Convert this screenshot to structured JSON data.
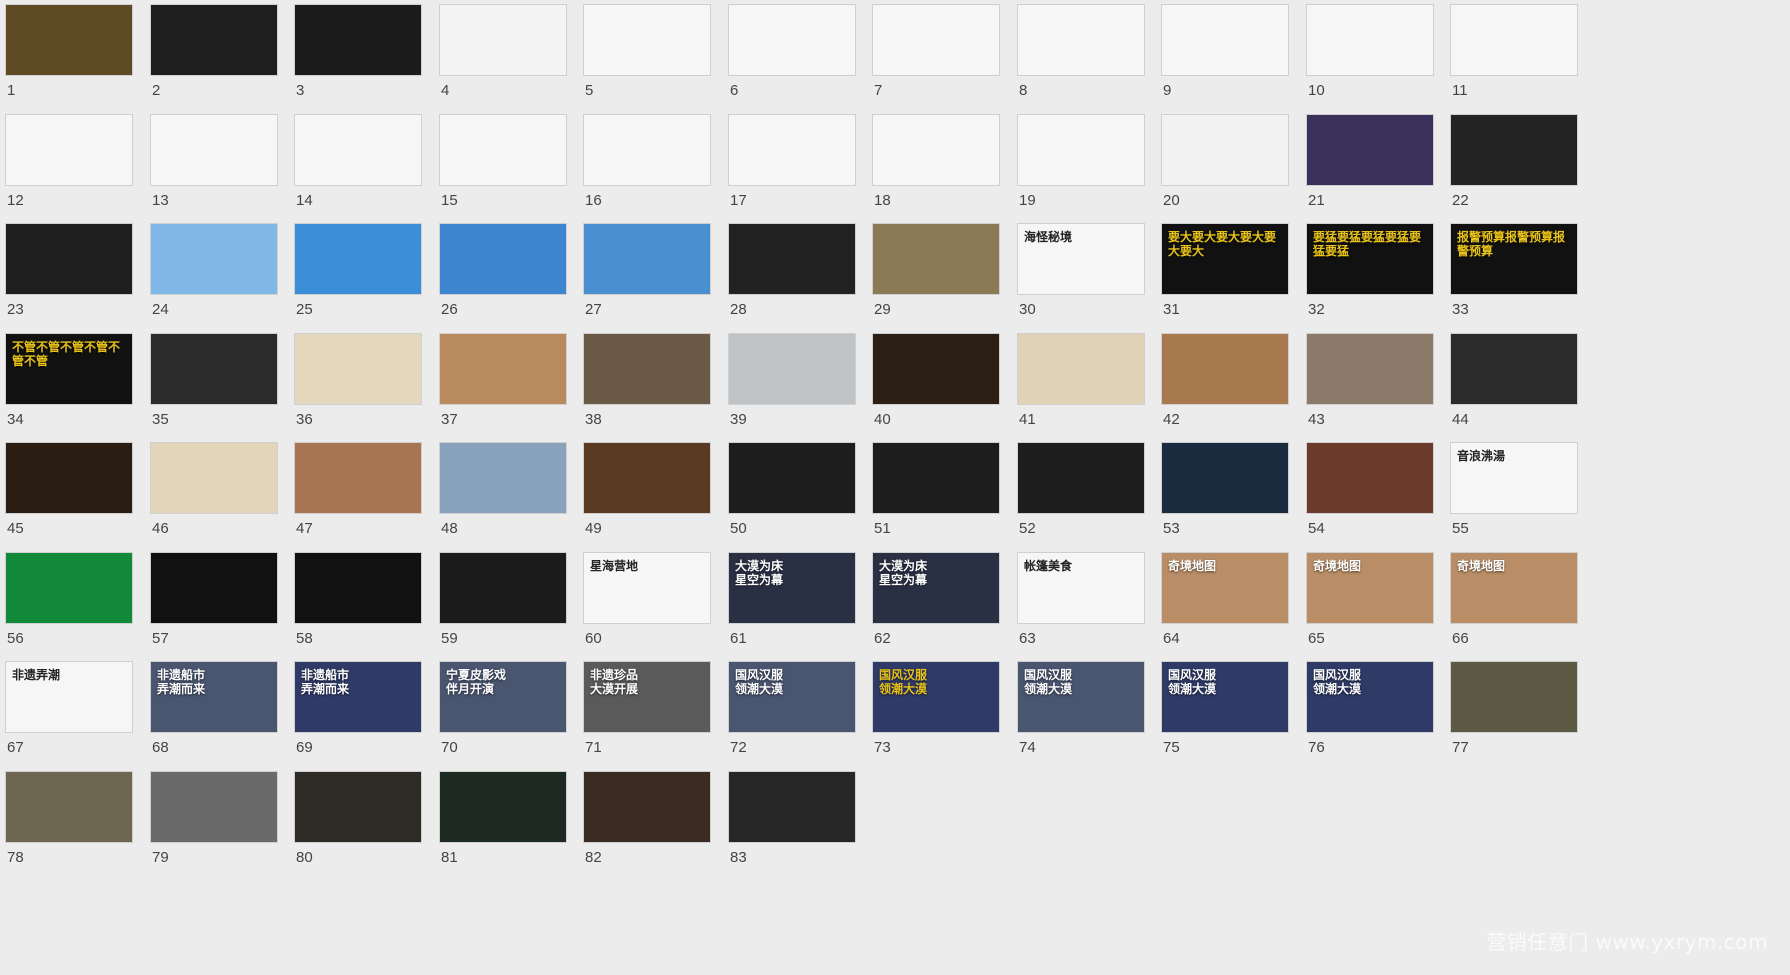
{
  "watermark": "营销任意门 www.yxrym.com",
  "slides": [
    {
      "n": "1",
      "bg": "#5e4a23"
    },
    {
      "n": "2",
      "bg": "#1f1f1f"
    },
    {
      "n": "3",
      "bg": "#1c1c1c"
    },
    {
      "n": "4",
      "bg": "#f4f4f4"
    },
    {
      "n": "5",
      "bg": "#f6f6f6"
    },
    {
      "n": "6",
      "bg": "#f6f6f6"
    },
    {
      "n": "7",
      "bg": "#f6f6f6"
    },
    {
      "n": "8",
      "bg": "#f6f6f6"
    },
    {
      "n": "9",
      "bg": "#f6f6f6"
    },
    {
      "n": "10",
      "bg": "#f6f6f6"
    },
    {
      "n": "11",
      "bg": "#f6f6f6"
    },
    {
      "n": "12",
      "bg": "#f6f6f6"
    },
    {
      "n": "13",
      "bg": "#f6f6f6"
    },
    {
      "n": "14",
      "bg": "#f6f6f6"
    },
    {
      "n": "15",
      "bg": "#f6f6f6"
    },
    {
      "n": "16",
      "bg": "#f6f6f6"
    },
    {
      "n": "17",
      "bg": "#f6f6f6"
    },
    {
      "n": "18",
      "bg": "#f6f6f6"
    },
    {
      "n": "19",
      "bg": "#f6f6f6"
    },
    {
      "n": "20",
      "bg": "#f2f2f2"
    },
    {
      "n": "21",
      "bg": "#3b2f5c"
    },
    {
      "n": "22",
      "bg": "#232323"
    },
    {
      "n": "23",
      "bg": "#1e1e1e"
    },
    {
      "n": "24",
      "bg": "#7fb8e6"
    },
    {
      "n": "25",
      "bg": "#3a8fd8"
    },
    {
      "n": "26",
      "bg": "#3d86cf"
    },
    {
      "n": "27",
      "bg": "#4a8fd0"
    },
    {
      "n": "28",
      "bg": "#222222"
    },
    {
      "n": "29",
      "bg": "#8a7a55"
    },
    {
      "n": "30",
      "bg": "#f6f6f6",
      "cap": "海怪秘境",
      "dark": true
    },
    {
      "n": "31",
      "bg": "#111111",
      "cap": "要大要大要大要大要大要大",
      "mark": "",
      "capColor": "#e8c21a"
    },
    {
      "n": "32",
      "bg": "#111111",
      "cap": "要猛要猛要猛要猛要猛要猛",
      "capColor": "#e8c21a"
    },
    {
      "n": "33",
      "bg": "#111111",
      "cap": "报警预算报警预算报警预算",
      "capColor": "#e8c21a"
    },
    {
      "n": "34",
      "bg": "#111111",
      "cap": "不管不管不管不管不管不管",
      "capColor": "#e8c21a"
    },
    {
      "n": "35",
      "bg": "#2b2b2b"
    },
    {
      "n": "36",
      "bg": "#e3d7be"
    },
    {
      "n": "37",
      "bg": "#b98a5e"
    },
    {
      "n": "38",
      "bg": "#6b5a46"
    },
    {
      "n": "39",
      "bg": "#bfc3c6"
    },
    {
      "n": "40",
      "bg": "#2c2016"
    },
    {
      "n": "41",
      "bg": "#e0d2b6"
    },
    {
      "n": "42",
      "bg": "#a8794e"
    },
    {
      "n": "43",
      "bg": "#8b7a6a"
    },
    {
      "n": "44",
      "bg": "#2b2b2b"
    },
    {
      "n": "45",
      "bg": "#2a1e14"
    },
    {
      "n": "46",
      "bg": "#e2d5ba"
    },
    {
      "n": "47",
      "bg": "#a77552"
    },
    {
      "n": "48",
      "bg": "#8aa3bd"
    },
    {
      "n": "49",
      "bg": "#5a3a22"
    },
    {
      "n": "50",
      "bg": "#1d1d1d"
    },
    {
      "n": "51",
      "bg": "#1d1d1d"
    },
    {
      "n": "52",
      "bg": "#1d1d1d"
    },
    {
      "n": "53",
      "bg": "#1a2b3f"
    },
    {
      "n": "54",
      "bg": "#6b3a2a"
    },
    {
      "n": "55",
      "bg": "#f6f6f6",
      "cap": "音浪沸湯",
      "dark": true
    },
    {
      "n": "56",
      "bg": "#138a3a"
    },
    {
      "n": "57",
      "bg": "#111111"
    },
    {
      "n": "58",
      "bg": "#111111"
    },
    {
      "n": "59",
      "bg": "#1c1c1c"
    },
    {
      "n": "60",
      "bg": "#f6f6f6",
      "cap": "星海营地",
      "dark": true
    },
    {
      "n": "61",
      "bg": "#2a3044",
      "cap": "大漠为床\n星空为幕"
    },
    {
      "n": "62",
      "bg": "#2a3044",
      "cap": "大漠为床\n星空为幕"
    },
    {
      "n": "63",
      "bg": "#f6f6f6",
      "cap": "帐篷美食",
      "dark": true
    },
    {
      "n": "64",
      "bg": "#b98d66",
      "cap": "奇境地图"
    },
    {
      "n": "65",
      "bg": "#b98d66",
      "cap": "奇境地图"
    },
    {
      "n": "66",
      "bg": "#b98d66",
      "cap": "奇境地图"
    },
    {
      "n": "67",
      "bg": "#f6f6f6",
      "cap": "非遗弄潮",
      "dark": true
    },
    {
      "n": "68",
      "bg": "#4a5570",
      "cap": "非遗船市\n弄潮而来"
    },
    {
      "n": "69",
      "bg": "#2f3a66",
      "cap": "非遗船市\n弄潮而来"
    },
    {
      "n": "70",
      "bg": "#4a5570",
      "cap": "宁夏皮影戏\n伴月开演"
    },
    {
      "n": "71",
      "bg": "#5a5a5a",
      "cap": "非遗珍品\n大漠开展"
    },
    {
      "n": "72",
      "bg": "#4a5570",
      "cap": "国风汉服\n领潮大漠"
    },
    {
      "n": "73",
      "bg": "#2f3a66",
      "cap": "国风汉服\n领潮大漠",
      "capColor": "#e8c21a"
    },
    {
      "n": "74",
      "bg": "#4a5570",
      "cap": "国风汉服\n领潮大漠"
    },
    {
      "n": "75",
      "bg": "#2f3a66",
      "cap": "国风汉服\n领潮大漠"
    },
    {
      "n": "76",
      "bg": "#2f3a66",
      "cap": "国风汉服\n领潮大漠"
    },
    {
      "n": "77",
      "bg": "#5c5a45"
    },
    {
      "n": "78",
      "bg": "#6e6650"
    },
    {
      "n": "79",
      "bg": "#6a6a6a"
    },
    {
      "n": "80",
      "bg": "#2e2a26"
    },
    {
      "n": "81",
      "bg": "#1d2a22"
    },
    {
      "n": "82",
      "bg": "#3a2b22"
    },
    {
      "n": "83",
      "bg": "#262626"
    }
  ]
}
